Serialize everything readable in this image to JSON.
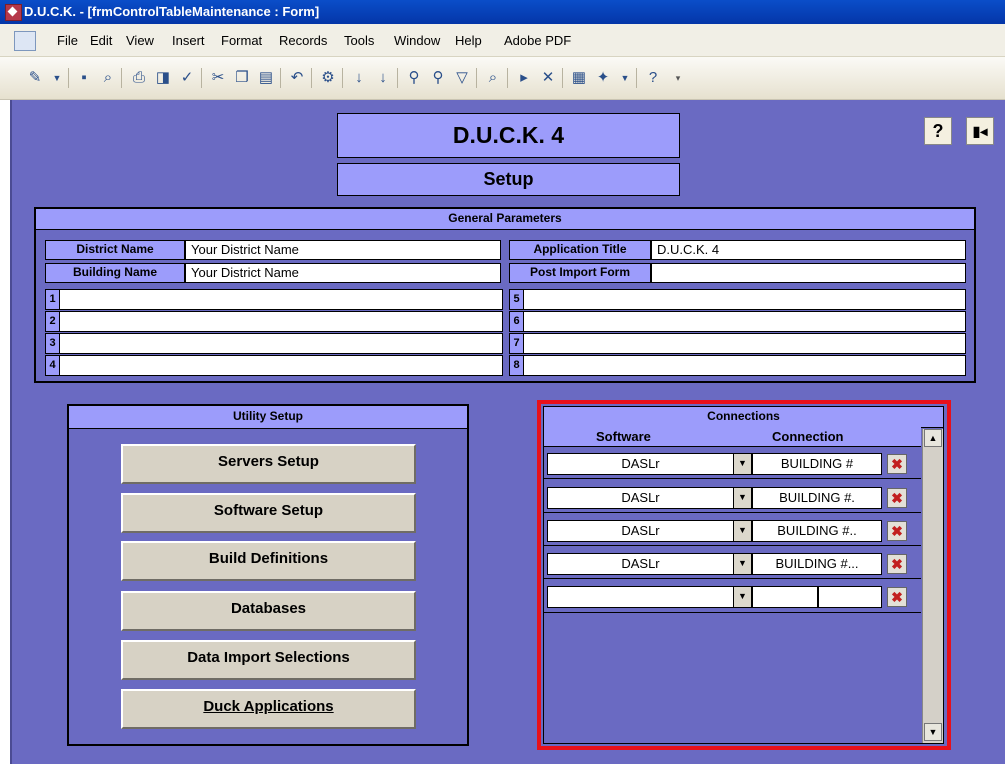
{
  "window": {
    "title": "D.U.C.K. - [frmControlTableMaintenance : Form]"
  },
  "menu": [
    "File",
    "Edit",
    "View",
    "Insert",
    "Format",
    "Records",
    "Tools",
    "Window",
    "Help",
    "Adobe PDF"
  ],
  "toolbar_icons": [
    "design-view-icon",
    "save-icon",
    "search-icon",
    "print-icon",
    "print-preview-icon",
    "spelling-icon",
    "cut-icon",
    "copy-icon",
    "paste-icon",
    "undo-icon",
    "hyperlink-icon",
    "sort-ascending-icon",
    "sort-descending-icon",
    "filter-by-selection-icon",
    "filter-by-form-icon",
    "apply-filter-icon",
    "find-icon",
    "new-record-icon",
    "delete-record-icon",
    "database-window-icon",
    "new-object-icon",
    "help-icon"
  ],
  "header": {
    "title": "D.U.C.K. 4",
    "subtitle": "Setup"
  },
  "general": {
    "title": "General Parameters",
    "district_label": "District Name",
    "district_value": "Your District Name",
    "building_label": "Building Name",
    "building_value": "Your District Name",
    "app_title_label": "Application Title",
    "app_title_value": "D.U.C.K. 4",
    "post_import_label": "Post Import Form",
    "post_import_value": "",
    "rows": [
      "1",
      "2",
      "3",
      "4",
      "5",
      "6",
      "7",
      "8"
    ]
  },
  "utility": {
    "title": "Utility Setup",
    "buttons": [
      "Servers Setup",
      "Software Setup",
      "Build Definitions",
      "Databases",
      "Data Import Selections",
      "Duck Applications"
    ]
  },
  "connections": {
    "title": "Connections",
    "col_software": "Software",
    "col_connection": "Connection",
    "rows": [
      {
        "software": "DASLr",
        "connection": "BUILDING #"
      },
      {
        "software": "DASLr",
        "connection": "BUILDING #."
      },
      {
        "software": "DASLr",
        "connection": "BUILDING #.."
      },
      {
        "software": "DASLr",
        "connection": "BUILDING #..."
      },
      {
        "software": "",
        "connection": ""
      }
    ]
  },
  "colors": {
    "form_bg": "#6a6ac2",
    "header_bg": "#9c9cfb",
    "highlight": "#e8101a"
  }
}
